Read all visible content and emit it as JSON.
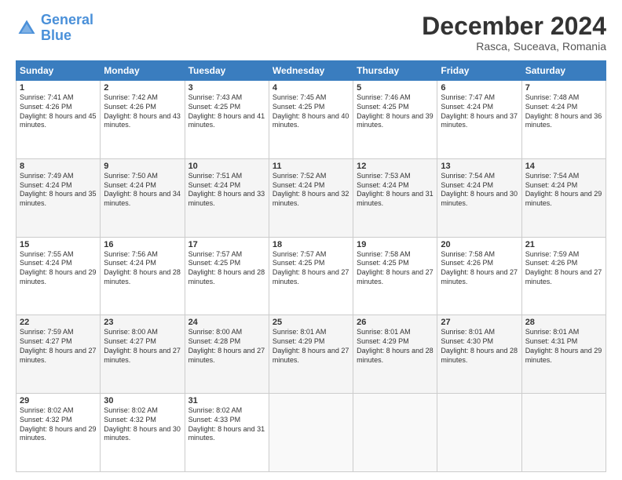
{
  "logo": {
    "line1": "General",
    "line2": "Blue"
  },
  "title": "December 2024",
  "subtitle": "Rasca, Suceava, Romania",
  "days": [
    "Sunday",
    "Monday",
    "Tuesday",
    "Wednesday",
    "Thursday",
    "Friday",
    "Saturday"
  ],
  "weeks": [
    [
      {
        "day": "1",
        "sunrise": "7:41 AM",
        "sunset": "4:26 PM",
        "daylight": "8 hours and 45 minutes."
      },
      {
        "day": "2",
        "sunrise": "7:42 AM",
        "sunset": "4:26 PM",
        "daylight": "8 hours and 43 minutes."
      },
      {
        "day": "3",
        "sunrise": "7:43 AM",
        "sunset": "4:25 PM",
        "daylight": "8 hours and 41 minutes."
      },
      {
        "day": "4",
        "sunrise": "7:45 AM",
        "sunset": "4:25 PM",
        "daylight": "8 hours and 40 minutes."
      },
      {
        "day": "5",
        "sunrise": "7:46 AM",
        "sunset": "4:25 PM",
        "daylight": "8 hours and 39 minutes."
      },
      {
        "day": "6",
        "sunrise": "7:47 AM",
        "sunset": "4:24 PM",
        "daylight": "8 hours and 37 minutes."
      },
      {
        "day": "7",
        "sunrise": "7:48 AM",
        "sunset": "4:24 PM",
        "daylight": "8 hours and 36 minutes."
      }
    ],
    [
      {
        "day": "8",
        "sunrise": "7:49 AM",
        "sunset": "4:24 PM",
        "daylight": "8 hours and 35 minutes."
      },
      {
        "day": "9",
        "sunrise": "7:50 AM",
        "sunset": "4:24 PM",
        "daylight": "8 hours and 34 minutes."
      },
      {
        "day": "10",
        "sunrise": "7:51 AM",
        "sunset": "4:24 PM",
        "daylight": "8 hours and 33 minutes."
      },
      {
        "day": "11",
        "sunrise": "7:52 AM",
        "sunset": "4:24 PM",
        "daylight": "8 hours and 32 minutes."
      },
      {
        "day": "12",
        "sunrise": "7:53 AM",
        "sunset": "4:24 PM",
        "daylight": "8 hours and 31 minutes."
      },
      {
        "day": "13",
        "sunrise": "7:54 AM",
        "sunset": "4:24 PM",
        "daylight": "8 hours and 30 minutes."
      },
      {
        "day": "14",
        "sunrise": "7:54 AM",
        "sunset": "4:24 PM",
        "daylight": "8 hours and 29 minutes."
      }
    ],
    [
      {
        "day": "15",
        "sunrise": "7:55 AM",
        "sunset": "4:24 PM",
        "daylight": "8 hours and 29 minutes."
      },
      {
        "day": "16",
        "sunrise": "7:56 AM",
        "sunset": "4:24 PM",
        "daylight": "8 hours and 28 minutes."
      },
      {
        "day": "17",
        "sunrise": "7:57 AM",
        "sunset": "4:25 PM",
        "daylight": "8 hours and 28 minutes."
      },
      {
        "day": "18",
        "sunrise": "7:57 AM",
        "sunset": "4:25 PM",
        "daylight": "8 hours and 27 minutes."
      },
      {
        "day": "19",
        "sunrise": "7:58 AM",
        "sunset": "4:25 PM",
        "daylight": "8 hours and 27 minutes."
      },
      {
        "day": "20",
        "sunrise": "7:58 AM",
        "sunset": "4:26 PM",
        "daylight": "8 hours and 27 minutes."
      },
      {
        "day": "21",
        "sunrise": "7:59 AM",
        "sunset": "4:26 PM",
        "daylight": "8 hours and 27 minutes."
      }
    ],
    [
      {
        "day": "22",
        "sunrise": "7:59 AM",
        "sunset": "4:27 PM",
        "daylight": "8 hours and 27 minutes."
      },
      {
        "day": "23",
        "sunrise": "8:00 AM",
        "sunset": "4:27 PM",
        "daylight": "8 hours and 27 minutes."
      },
      {
        "day": "24",
        "sunrise": "8:00 AM",
        "sunset": "4:28 PM",
        "daylight": "8 hours and 27 minutes."
      },
      {
        "day": "25",
        "sunrise": "8:01 AM",
        "sunset": "4:29 PM",
        "daylight": "8 hours and 27 minutes."
      },
      {
        "day": "26",
        "sunrise": "8:01 AM",
        "sunset": "4:29 PM",
        "daylight": "8 hours and 28 minutes."
      },
      {
        "day": "27",
        "sunrise": "8:01 AM",
        "sunset": "4:30 PM",
        "daylight": "8 hours and 28 minutes."
      },
      {
        "day": "28",
        "sunrise": "8:01 AM",
        "sunset": "4:31 PM",
        "daylight": "8 hours and 29 minutes."
      }
    ],
    [
      {
        "day": "29",
        "sunrise": "8:02 AM",
        "sunset": "4:32 PM",
        "daylight": "8 hours and 29 minutes."
      },
      {
        "day": "30",
        "sunrise": "8:02 AM",
        "sunset": "4:32 PM",
        "daylight": "8 hours and 30 minutes."
      },
      {
        "day": "31",
        "sunrise": "8:02 AM",
        "sunset": "4:33 PM",
        "daylight": "8 hours and 31 minutes."
      },
      null,
      null,
      null,
      null
    ]
  ]
}
